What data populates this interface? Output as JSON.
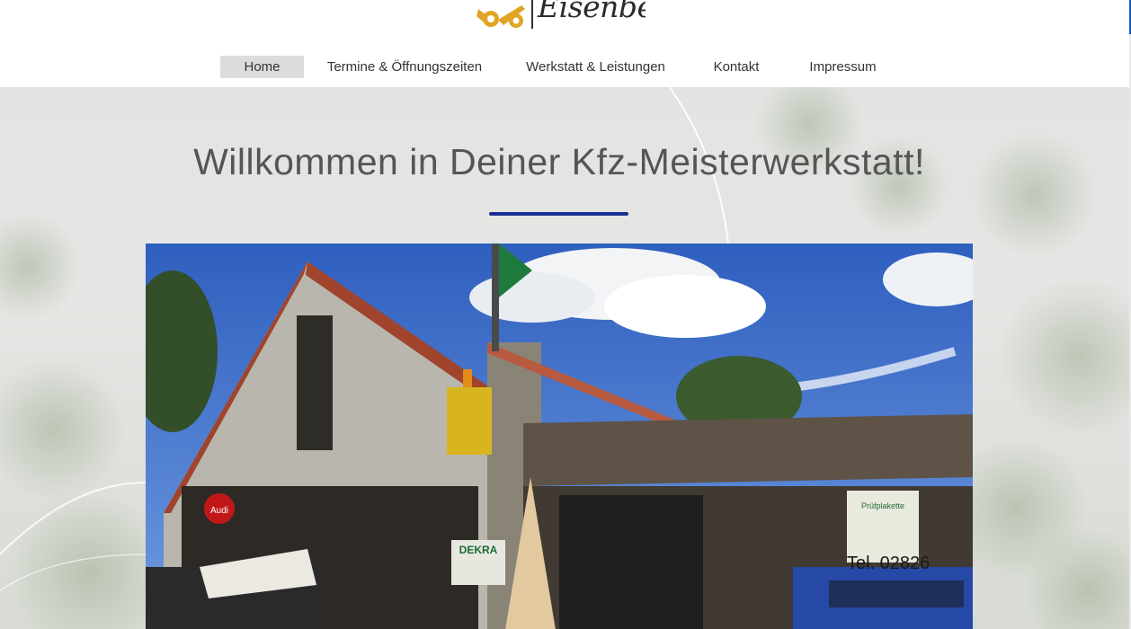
{
  "logo": {
    "text": "Eisenberger"
  },
  "nav": {
    "items": [
      {
        "label": "Home",
        "active": true
      },
      {
        "label": "Termine & Öffnungszeiten",
        "active": false
      },
      {
        "label": "Werkstatt & Leistungen",
        "active": false
      },
      {
        "label": "Kontakt",
        "active": false
      },
      {
        "label": "Impressum",
        "active": false
      }
    ]
  },
  "hero": {
    "title": "Willkommen in Deiner Kfz-Meisterwerkstatt!"
  },
  "photo": {
    "signs": {
      "audi": "Audi",
      "dekra": "DEKRA",
      "plakette": "Prüfplakette",
      "phone": "Tel. 02826"
    }
  },
  "colors": {
    "accent_divider": "#1b2f93",
    "nav_active_bg": "#dcdcdc",
    "logo_gold": "#e0a526"
  }
}
